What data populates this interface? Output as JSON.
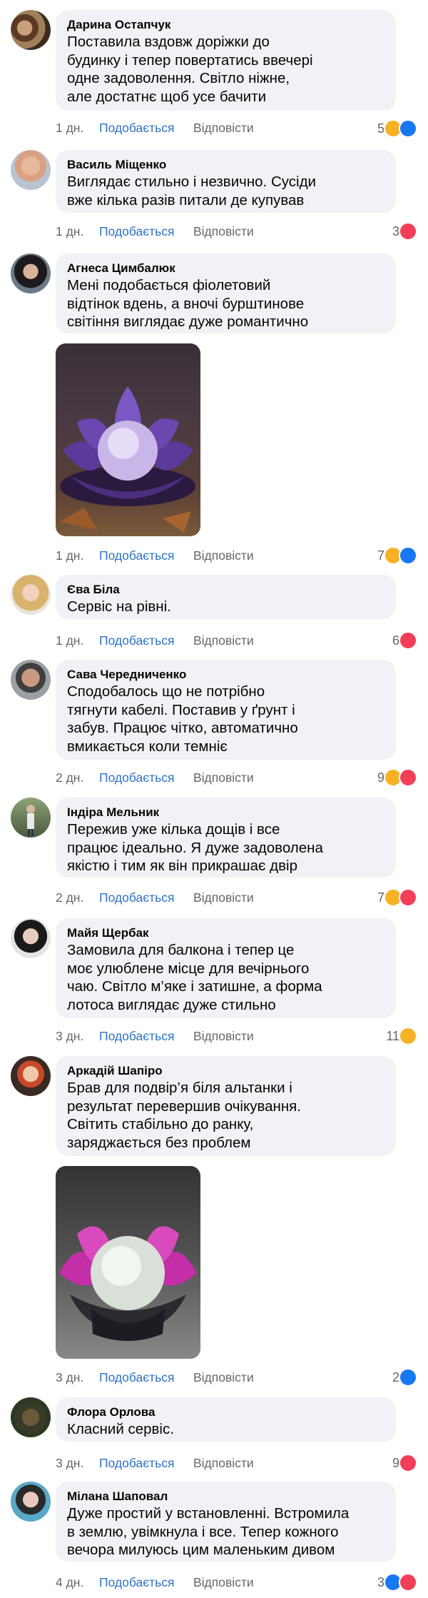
{
  "actions": {
    "like": "Подобається",
    "reply": "Відповісти"
  },
  "comments": [
    {
      "author": "Дарина Остапчук",
      "text": "Поставила вздовж доріжки до\nбудинку і тепер повертатись ввечері\nодне задоволення. Світло ніжне,\nале достатнє щоб усе бачити",
      "time": "1 дн.",
      "count": "5",
      "reactions": [
        "haha-icon",
        "like-icon"
      ]
    },
    {
      "author": "Василь Міщенко",
      "text": "Виглядає стильно і незвично. Сусіди\nвже кілька разів питали де купував",
      "time": "1 дн.",
      "count": "3",
      "reactions": [
        "love-icon"
      ]
    },
    {
      "author": "Агнеса Цимбалюк",
      "text": "Мені подобається фіолетовий\nвідтінок вдень, а вночі бурштинове\nсвітіння виглядає дуже романтично",
      "time": "1 дн.",
      "count": "7",
      "reactions": [
        "haha-icon",
        "like-icon"
      ],
      "photo": "purple-lotus-lamp"
    },
    {
      "author": "Єва Біла",
      "text": "Сервіс на рівні.",
      "time": "1 дн.",
      "count": "6",
      "reactions": [
        "love-icon"
      ]
    },
    {
      "author": "Сава Чередниченко",
      "text": "Сподобалось що не потрібно\nтягнути кабелі. Поставив у ґрунт і\nзабув. Працює чітко, автоматично\nвмикається коли темніє",
      "time": "2 дн.",
      "count": "9",
      "reactions": [
        "haha-icon",
        "love-icon"
      ]
    },
    {
      "author": "Індіра Мельник",
      "text": "Пережив уже кілька дощів і все\nпрацює ідеально. Я дуже задоволена\nякістю і тим як він прикрашає двір",
      "time": "2 дн.",
      "count": "7",
      "reactions": [
        "haha-icon",
        "love-icon"
      ]
    },
    {
      "author": "Майя Щербак",
      "text": "Замовила для балкона і тепер це\nмоє улюблене місце для вечірнього\nчаю. Світло м’яке і затишне, а форма\nлотоса виглядає дуже стильно",
      "time": "3 дн.",
      "count": "11",
      "reactions": [
        "haha-icon"
      ]
    },
    {
      "author": "Аркадій Шапіро",
      "text": "Брав для подвір’я біля альтанки і\nрезультат перевершив очікування.\nСвітить стабільно до ранку,\nзаряджається без проблем",
      "time": "3 дн.",
      "count": "2",
      "reactions": [
        "like-icon"
      ],
      "photo": "pink-lotus-lamp"
    },
    {
      "author": "Флора Орлова",
      "text": "Класний сервіс.",
      "time": "3 дн.",
      "count": "9",
      "reactions": [
        "love-icon"
      ]
    },
    {
      "author": "Мілана Шаповал",
      "text": "Дуже простий у встановленні. Встромила\nв землю, увімкнула і все. Тепер кожного\nвечора милуюсь цим маленьким дивом",
      "time": "4 дн.",
      "count": "3",
      "reactions": [
        "like-icon",
        "love-icon"
      ]
    }
  ]
}
